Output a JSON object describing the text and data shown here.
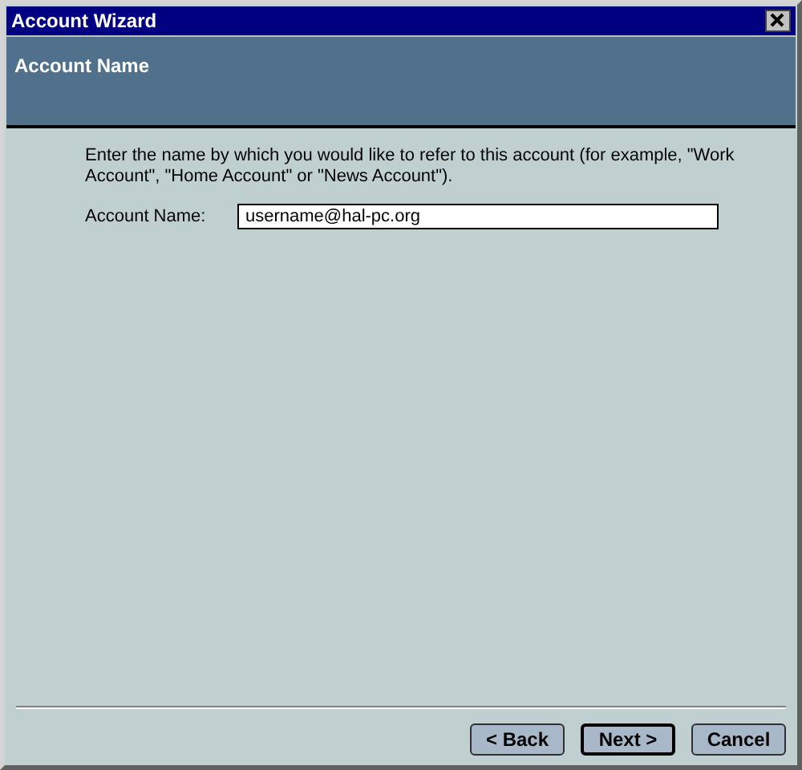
{
  "window": {
    "title": "Account Wizard"
  },
  "header": {
    "title": "Account Name"
  },
  "instructions": "Enter the name by which you would like to refer to this account (for example, \"Work Account\", \"Home Account\" or \"News Account\").",
  "field": {
    "label": "Account Name:",
    "value": "username@hal-pc.org"
  },
  "buttons": [
    {
      "label": "< Back",
      "default": false
    },
    {
      "label": "Next >",
      "default": true
    },
    {
      "label": "Cancel",
      "default": false
    }
  ]
}
